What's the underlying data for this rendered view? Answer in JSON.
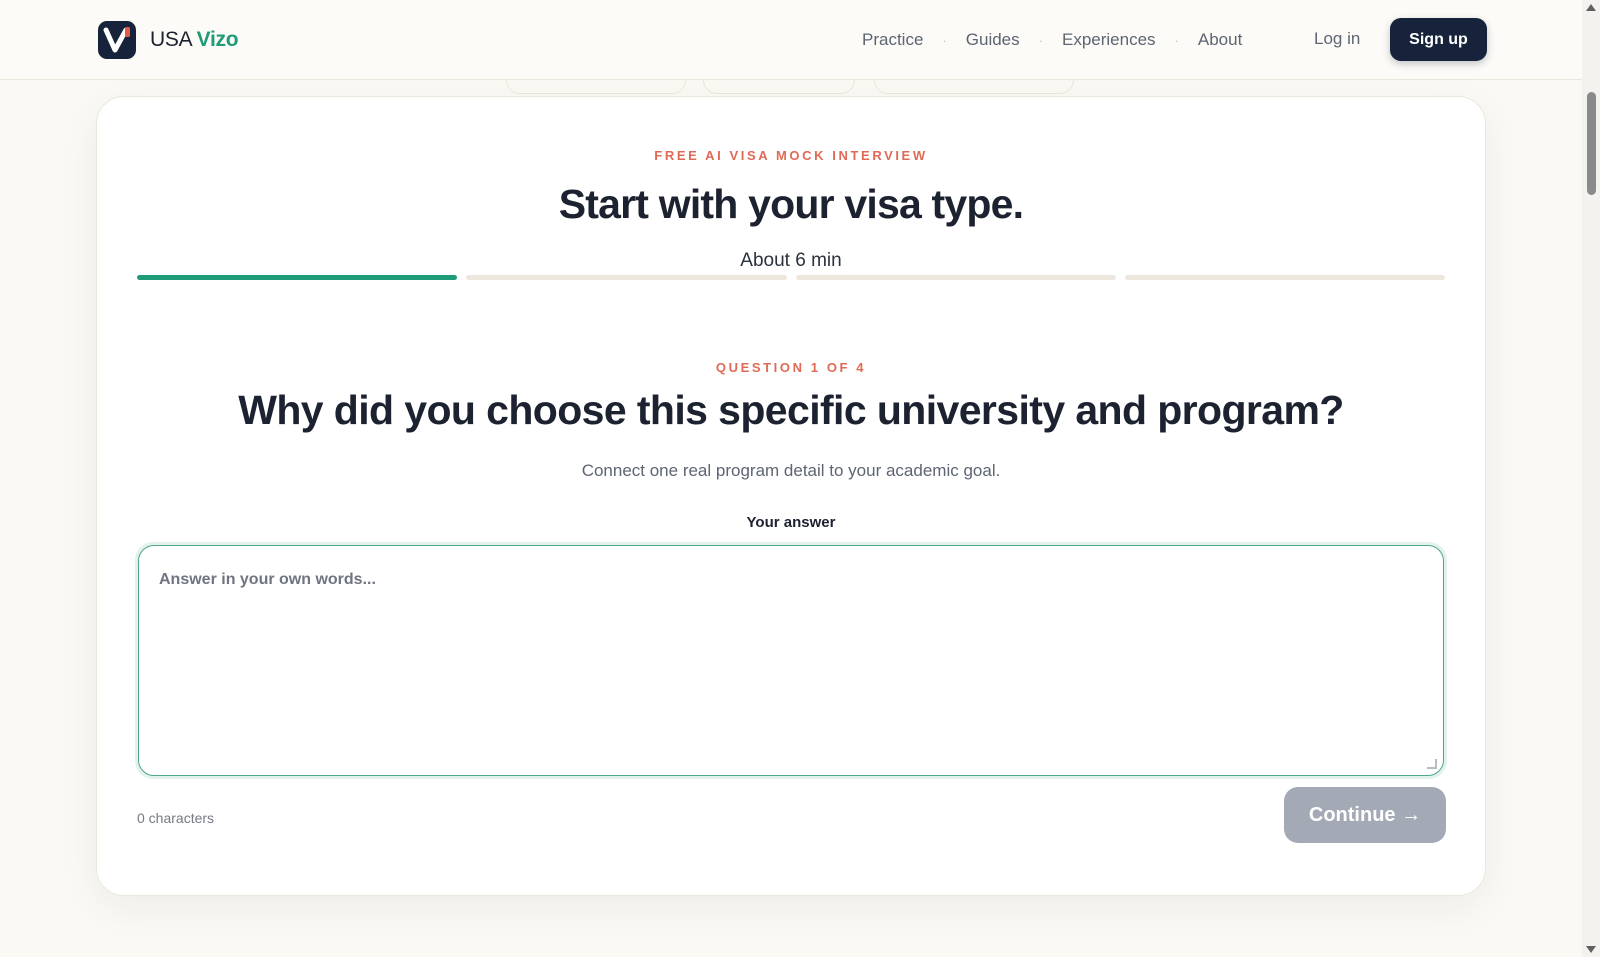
{
  "header": {
    "brand_prefix": "USA",
    "brand_accent": "Vizo",
    "nav": [
      {
        "label": "Practice"
      },
      {
        "label": "Guides"
      },
      {
        "label": "Experiences"
      },
      {
        "label": "About"
      }
    ],
    "login_label": "Log in",
    "signup_label": "Sign up"
  },
  "card": {
    "eyebrow": "FREE AI VISA MOCK INTERVIEW",
    "headline": "Start with your visa type.",
    "duration": "About 6 min",
    "progress": {
      "current_step": 1,
      "total_steps": 4
    },
    "question_counter": "QUESTION 1 OF 4",
    "question": "Why did you choose this specific university and program?",
    "hint": "Connect one real program detail to your academic goal.",
    "answer_label": "Your answer",
    "answer_placeholder": "Answer in your own words...",
    "answer_value": "",
    "char_count": "0 characters",
    "continue_label": "Continue →"
  },
  "colors": {
    "accent_green": "#1f9b78",
    "navy": "#16233a",
    "eyebrow_coral": "#e06a55",
    "disabled_button": "#a3aab6",
    "page_bg": "#fbf9f4"
  },
  "icons": {
    "logo": "v-check-logo-icon"
  }
}
